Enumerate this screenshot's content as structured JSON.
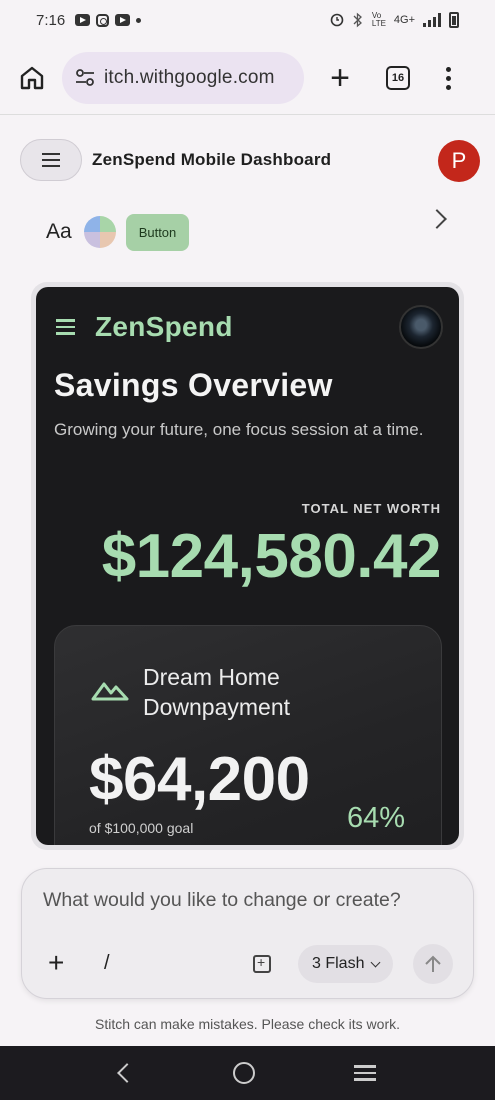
{
  "status_bar": {
    "time": "7:16",
    "network": "4G+",
    "volte": "Vo LTE",
    "icons": [
      "youtube-icon",
      "instagram-icon",
      "youtube-icon",
      "notification-dot-icon",
      "alarm-icon",
      "bluetooth-icon",
      "signal-icon",
      "battery-icon"
    ]
  },
  "browser": {
    "url": "itch.withgoogle.com",
    "tab_count": "16"
  },
  "app": {
    "project_title": "ZenSpend Mobile Dashboard",
    "avatar_initial": "P",
    "theme": {
      "font_label": "Aa",
      "button_chip_label": "Button"
    }
  },
  "preview": {
    "brand": "ZenSpend",
    "title": "Savings Overview",
    "subtitle": "Growing your future, one focus session at a time.",
    "net_worth_label": "TOTAL NET WORTH",
    "net_worth_value": "$124,580.42",
    "goal": {
      "name": "Dream Home Downpayment",
      "amount": "$64,200",
      "of_goal": "of $100,000 goal",
      "percent": "64%"
    },
    "colors": {
      "accent": "#a7dcb0",
      "background": "#1a1a1c"
    }
  },
  "prompt": {
    "placeholder": "What would you like to change or create?",
    "slash": "/",
    "model_label": "3 Flash"
  },
  "disclaimer": "Stitch can make mistakes. Please check its work."
}
